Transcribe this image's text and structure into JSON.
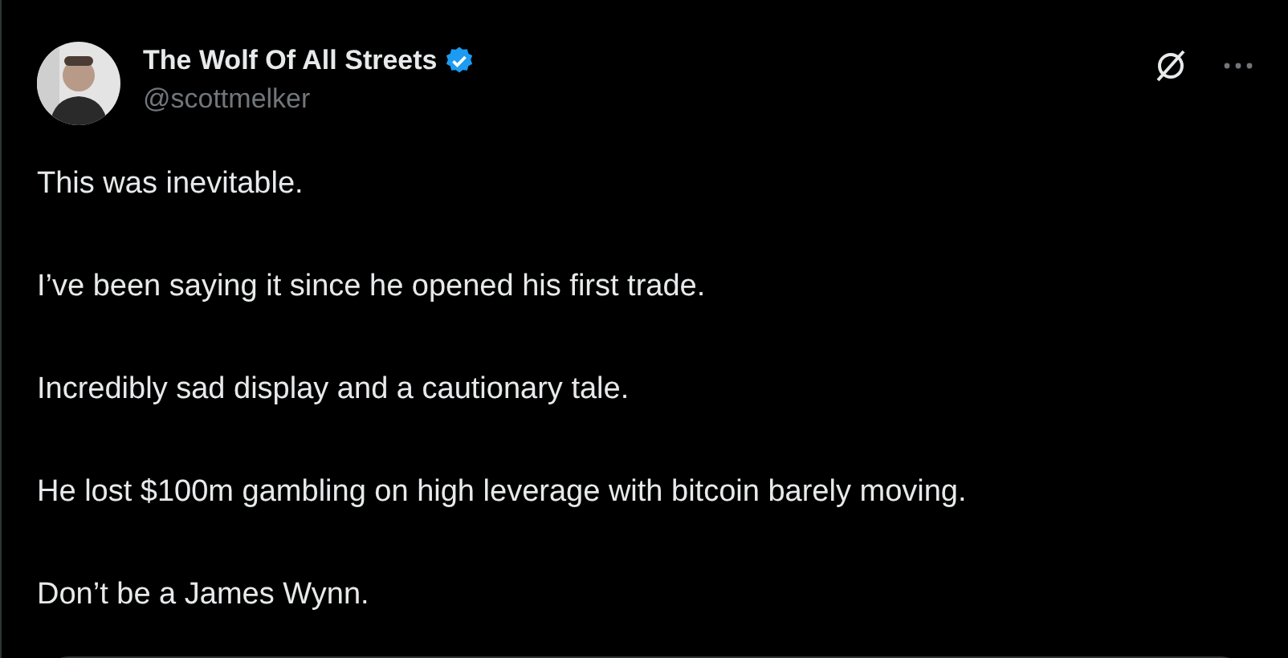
{
  "author": {
    "name": "The Wolf Of All Streets",
    "verified": true,
    "handle": "@scottmelker"
  },
  "paragraphs": [
    "This was inevitable.",
    "I’ve been saying it since he opened his first trade.",
    "Incredibly sad display and a cautionary tale.",
    "He lost $100m gambling on high leverage with bitcoin barely moving.",
    "Don’t be a James Wynn."
  ],
  "quote": {
    "kind": "card"
  }
}
